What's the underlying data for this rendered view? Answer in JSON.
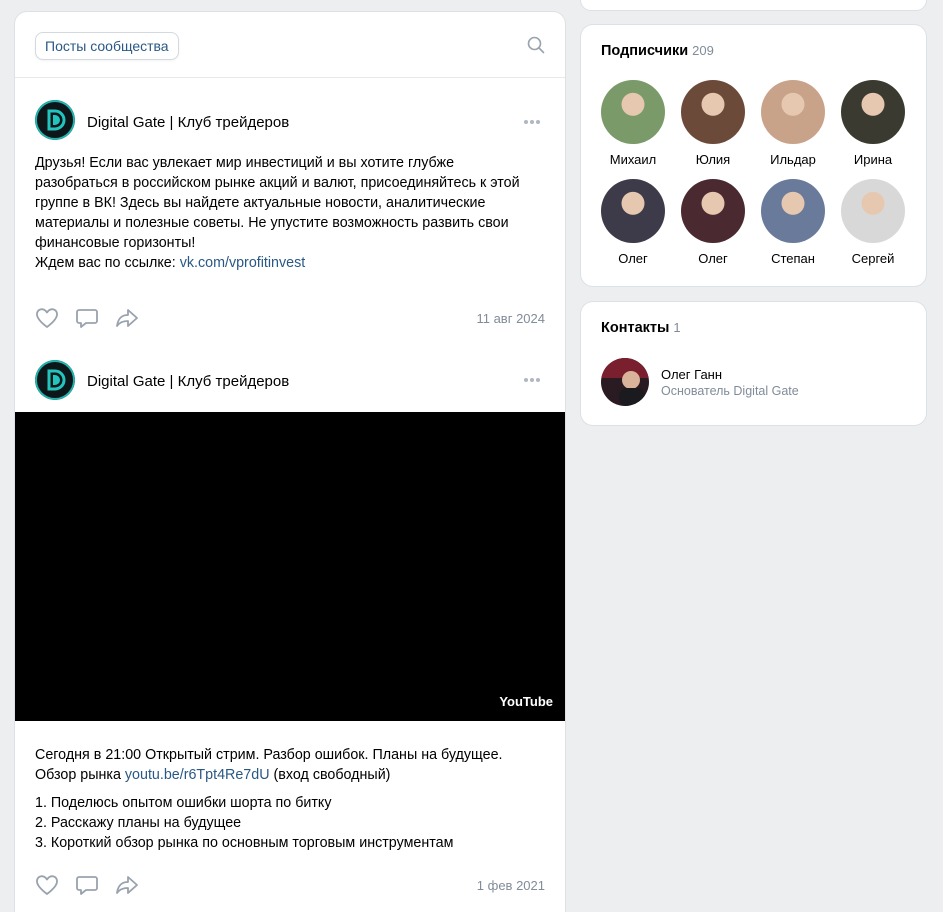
{
  "feed": {
    "tab_label": "Посты сообщества",
    "posts": [
      {
        "author": "Digital Gate | Клуб трейдеров",
        "text_lines": [
          "Друзья! Если вас увлекает мир инвестиций и вы хотите глубже",
          "разобраться в российском рынке акций и валют, присоединяйтесь к этой",
          "группе в ВК! Здесь вы найдете актуальные новости, аналитические",
          "материалы и полезные советы. Не упустите возможность развить свои",
          "финансовые горизонты!"
        ],
        "link_prefix": "Ждем вас по ссылке: ",
        "link": "vk.com/vprofitinvest",
        "date": "11 авг 2024"
      },
      {
        "author": "Digital Gate | Клуб трейдеров",
        "video_label": "YouTube",
        "text_line1": "Сегодня в 21:00 Открытый стрим. Разбор ошибок. Планы на будущее.",
        "text_line2_prefix": "Обзор рынка ",
        "text_line2_link": "youtu.be/r6Tpt4Re7dU",
        "text_line2_suffix": " (вход свободный)",
        "list": [
          "1. Поделюсь опытом ошибки шорта по битку",
          "2. Расскажу планы на будущее",
          "3. Короткий обзор рынка по основным торговым инструментам"
        ],
        "date": "1 фев 2021"
      }
    ]
  },
  "subscribers": {
    "title": "Подписчики",
    "count": "209",
    "people": [
      {
        "name": "Михаил",
        "color": "#7a9a6a"
      },
      {
        "name": "Юлия",
        "color": "#6b4a3a"
      },
      {
        "name": "Ильдар",
        "color": "#c9a28a"
      },
      {
        "name": "Ирина",
        "color": "#3a3a30"
      },
      {
        "name": "Олег",
        "color": "#3d3b4a"
      },
      {
        "name": "Олег",
        "color": "#4a2a30"
      },
      {
        "name": "Степан",
        "color": "#6a7a9a"
      },
      {
        "name": "Сергей",
        "color": "#d8d8d8"
      }
    ]
  },
  "contacts": {
    "title": "Контакты",
    "count": "1",
    "name": "Олег Ганн",
    "role": "Основатель Digital Gate"
  }
}
